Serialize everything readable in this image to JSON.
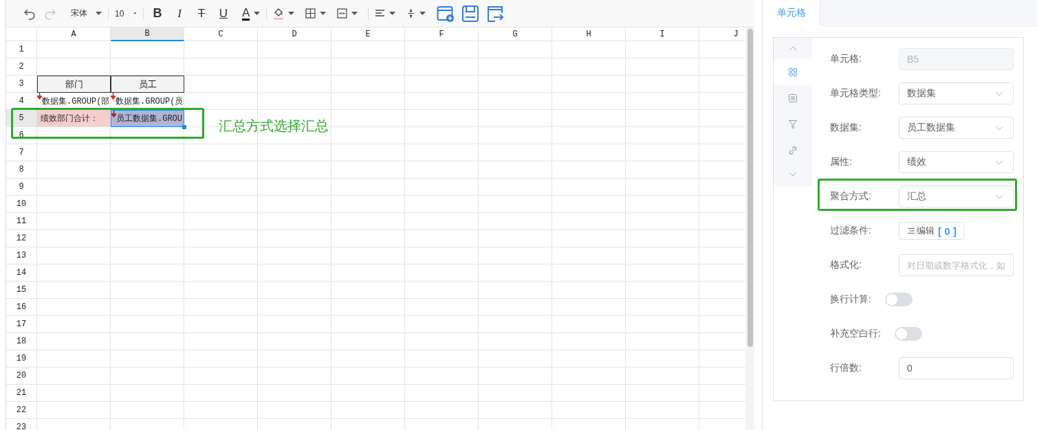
{
  "toolbar": {
    "history": [
      {
        "kind": "undo",
        "disabled": false
      },
      {
        "kind": "redo",
        "disabled": true
      }
    ],
    "font_name": "宋体",
    "font_size": "10",
    "format_buttons": [
      {
        "kind": "bold",
        "label": "B"
      },
      {
        "kind": "italic",
        "label": "I"
      },
      {
        "kind": "strike",
        "label": "T"
      },
      {
        "kind": "underline",
        "label": "U"
      },
      {
        "kind": "color",
        "label": "A"
      }
    ],
    "tools": [
      {
        "kind": "fill"
      },
      {
        "kind": "border"
      },
      {
        "kind": "merge"
      },
      {
        "kind": "align"
      },
      {
        "kind": "valign"
      },
      {
        "kind": "add-sheet"
      },
      {
        "kind": "save"
      },
      {
        "kind": "export"
      }
    ]
  },
  "sheet": {
    "columns": [
      {
        "label": "A",
        "selected": false
      },
      {
        "label": "B",
        "selected": true
      },
      {
        "label": "C",
        "selected": false
      },
      {
        "label": "D",
        "selected": false
      },
      {
        "label": "E",
        "selected": false
      },
      {
        "label": "F",
        "selected": false
      },
      {
        "label": "G",
        "selected": false
      },
      {
        "label": "H",
        "selected": false
      },
      {
        "label": "I",
        "selected": false
      },
      {
        "label": "J",
        "selected": false
      }
    ],
    "rows": [
      {
        "label": "1",
        "selected": false
      },
      {
        "label": "2",
        "selected": false
      },
      {
        "label": "3",
        "selected": false,
        "cells": [
          {
            "kind": "header",
            "text": "部门",
            "selected": false
          },
          {
            "kind": "header",
            "text": "员工",
            "selected": false
          }
        ]
      },
      {
        "label": "4",
        "selected": false,
        "cells": [
          {
            "kind": "field",
            "text": "数据集.GROUP(部",
            "selected": false
          },
          {
            "kind": "field",
            "text": "数据集.GROUP(员",
            "selected": false
          }
        ]
      },
      {
        "label": "5",
        "selected": true,
        "cells": [
          {
            "kind": "label",
            "text": "绩效部门合计：",
            "selected": false
          },
          {
            "kind": "field",
            "text": "员工数据集.GROU",
            "selected": true
          }
        ]
      },
      {
        "label": "6",
        "selected": false
      },
      {
        "label": "7",
        "selected": false
      },
      {
        "label": "8",
        "selected": false
      },
      {
        "label": "9",
        "selected": false
      },
      {
        "label": "10",
        "selected": false
      },
      {
        "label": "11",
        "selected": false
      },
      {
        "label": "12",
        "selected": false
      },
      {
        "label": "13",
        "selected": false
      },
      {
        "label": "14",
        "selected": false
      },
      {
        "label": "15",
        "selected": false
      },
      {
        "label": "16",
        "selected": false
      },
      {
        "label": "17",
        "selected": false
      },
      {
        "label": "18",
        "selected": false
      },
      {
        "label": "19",
        "selected": false
      },
      {
        "label": "20",
        "selected": false
      },
      {
        "label": "21",
        "selected": false
      },
      {
        "label": "22",
        "selected": false
      },
      {
        "label": "23",
        "selected": false
      }
    ],
    "annotation": {
      "text": "汇总方式选择汇总"
    }
  },
  "panel": {
    "tabs": [
      {
        "label": "单元格",
        "selected": true
      }
    ],
    "side_nav": [
      {
        "kind": "up",
        "selected": false
      },
      {
        "kind": "grid",
        "selected": true
      },
      {
        "kind": "list",
        "selected": false
      },
      {
        "kind": "filter",
        "selected": false
      },
      {
        "kind": "link",
        "selected": false
      },
      {
        "kind": "down",
        "selected": false
      }
    ],
    "form": [
      {
        "kind": "readonly",
        "label": "单元格:",
        "value": "B5",
        "highlighted": false
      },
      {
        "kind": "select",
        "label": "单元格类型:",
        "value": "数据集",
        "highlighted": false
      },
      {
        "kind": "select",
        "label": "数据集:",
        "value": "员工数据集",
        "highlighted": false
      },
      {
        "kind": "select",
        "label": "属性:",
        "value": "绩效",
        "highlighted": false
      },
      {
        "kind": "select",
        "label": "聚合方式:",
        "value": "汇总",
        "highlighted": true
      },
      {
        "kind": "button",
        "label": "过滤条件:",
        "button": "编辑",
        "count": "[ 0 ]",
        "highlighted": false
      },
      {
        "kind": "input",
        "label": "格式化:",
        "placeholder": "对日期或数字格式化，如",
        "highlighted": false
      },
      {
        "kind": "switch",
        "label": "换行计算:",
        "on": false,
        "highlighted": false
      },
      {
        "kind": "switch",
        "label": "补充空白行:",
        "on": false,
        "highlighted": false
      },
      {
        "kind": "input",
        "label": "行倍数:",
        "value": "0",
        "highlighted": false
      }
    ]
  }
}
